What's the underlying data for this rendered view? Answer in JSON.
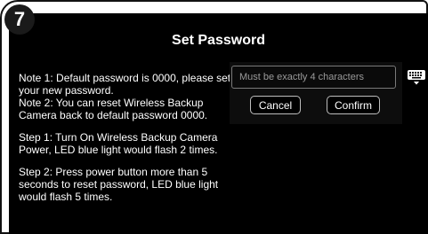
{
  "step_badge": "7",
  "title": "Set Password",
  "notes": [
    "Note 1: Default password is 0000, please set your new password.",
    "Note 2: You can reset Wireless Backup Camera back to default password 0000."
  ],
  "steps": [
    "Step 1: Turn On Wireless Backup Camera Power, LED blue light would flash 2 times.",
    "Step 2: Press power button more than 5 seconds to reset password, LED blue light would flash 5 times."
  ],
  "password_input": {
    "value": "",
    "placeholder": "Must be exactly 4 characters"
  },
  "buttons": {
    "cancel": "Cancel",
    "confirm": "Confirm"
  },
  "icons": {
    "keyboard": "keyboard-icon"
  },
  "colors": {
    "screen_bg": "#000000",
    "text": "#ffffff",
    "input_border": "#7a7a7a"
  }
}
